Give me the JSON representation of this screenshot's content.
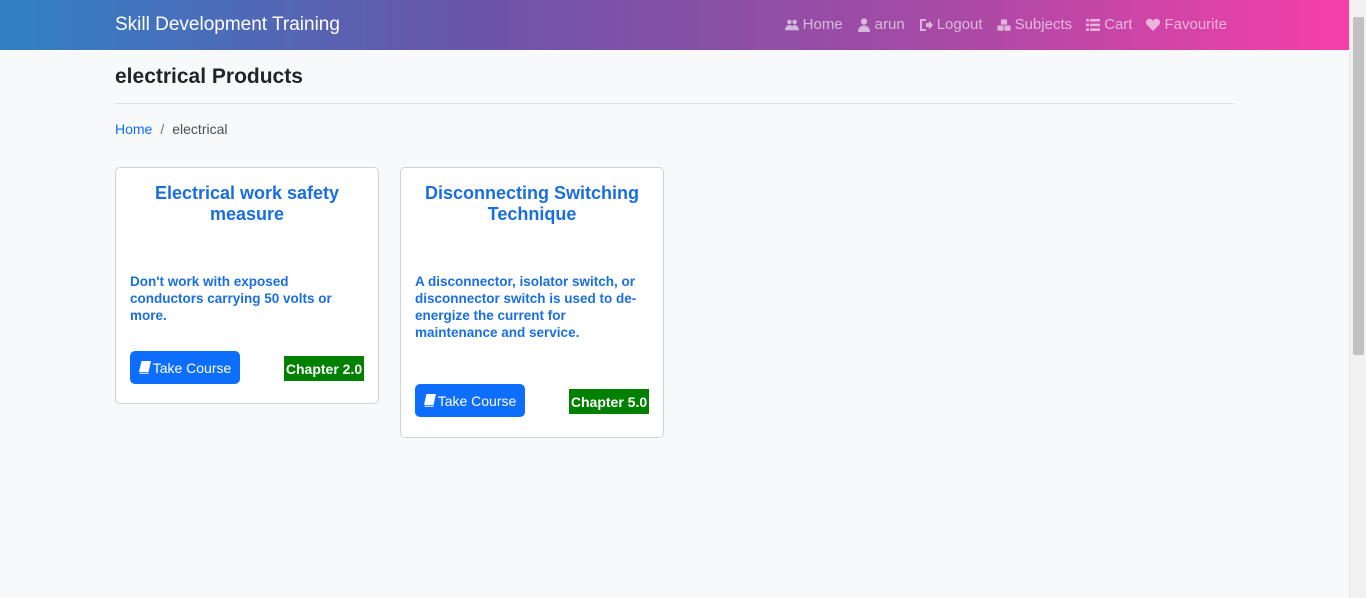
{
  "navbar": {
    "brand": "Skill Development Training",
    "links": [
      {
        "label": "Home",
        "icon": "users-icon"
      },
      {
        "label": "arun",
        "icon": "user-icon"
      },
      {
        "label": "Logout",
        "icon": "sign-out-icon"
      },
      {
        "label": "Subjects",
        "icon": "cubes-icon"
      },
      {
        "label": "Cart",
        "icon": "list-icon"
      },
      {
        "label": "Favourite",
        "icon": "heart-icon"
      }
    ]
  },
  "page": {
    "title": "electrical Products"
  },
  "breadcrumb": {
    "home": "Home",
    "separator": "/",
    "current": "electrical"
  },
  "cards": [
    {
      "title": "Electrical work safety measure",
      "text": "Don't work with exposed conductors carrying 50 volts or more.",
      "button": "Take Course",
      "badge": "Chapter 2.0"
    },
    {
      "title": "Disconnecting Switching Technique",
      "text": "A disconnector, isolator switch, or disconnector switch is used to de-energize the current for maintenance and service.",
      "button": "Take Course",
      "badge": "Chapter 5.0"
    }
  ],
  "colors": {
    "accent": "#0d6efd",
    "card_text": "#1a6fe0",
    "badge": "#008000"
  }
}
